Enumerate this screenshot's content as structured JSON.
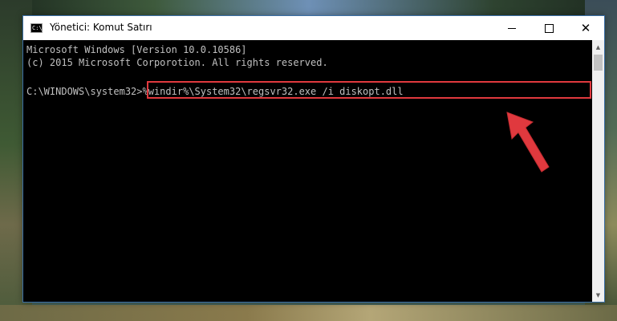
{
  "window": {
    "title": "Yönetici: Komut Satırı",
    "icon": "cmd-icon",
    "icon_text": "C:\\",
    "controls": {
      "minimize": "minimize-icon",
      "maximize": "maximize-icon",
      "close": "close-icon",
      "close_glyph": "✕"
    }
  },
  "console": {
    "line1": "Microsoft Windows [Version 10.0.10586]",
    "line2": "(c) 2015 Microsoft Corporotion. All rights reserved.",
    "prompt": "C:\\WINDOWS\\system32>",
    "command": "%windir%\\System32\\regsvr32.exe /i diskopt.dll"
  },
  "annotation": {
    "highlight_color": "#e0393e",
    "arrow_color": "#e0393e",
    "arrow_icon": "red-arrow-icon"
  },
  "scrollbar": {
    "up_glyph": "▲",
    "down_glyph": "▼"
  }
}
